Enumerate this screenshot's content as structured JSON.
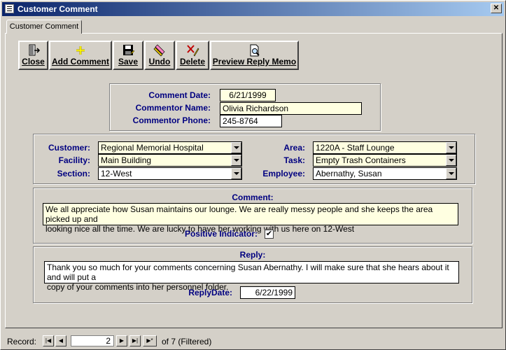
{
  "window": {
    "title": "Customer Comment"
  },
  "tab": {
    "label": "Customer Comment"
  },
  "toolbar": {
    "close": "Close",
    "add_comment": "Add Comment",
    "save": "Save",
    "undo": "Undo",
    "delete": "Delete",
    "preview_reply_memo": "Preview Reply Memo"
  },
  "commentor": {
    "date_label": "Comment Date:",
    "date": "6/21/1999",
    "name_label": "Commentor Name:",
    "name": "Olivia Richardson",
    "phone_label": "Commentor Phone:",
    "phone": "245-8764"
  },
  "location": {
    "customer_label": "Customer:",
    "customer": "Regional Memorial Hospital",
    "facility_label": "Facility:",
    "facility": "Main Building",
    "section_label": "Section:",
    "section": "12-West",
    "area_label": "Area:",
    "area": "1220A - Staff Lounge",
    "task_label": "Task:",
    "task": "Empty Trash Containers",
    "employee_label": "Employee:",
    "employee": "Abernathy, Susan"
  },
  "comment": {
    "label": "Comment:",
    "line1": "We all appreciate how Susan maintains our lounge.  We are really messy people and she keeps the area picked up and",
    "line2": "looking nice all the time.  We are lucky to have her working with us here on 12-West",
    "positive_label": "Positive Indicator:",
    "positive_mark": "✔"
  },
  "reply": {
    "label": "Reply:",
    "line1": "Thank you so much for your comments concerning Susan Abernathy.  I will make sure that she hears about it and will put a",
    "line2": "copy of your comments into her personnel folder.",
    "date_label": "ReplyDate:",
    "date": "6/22/1999"
  },
  "navigation": {
    "record_label": "Record:",
    "current": "2",
    "of_text": "of  7 (Filtered)"
  },
  "colors": {
    "title_start": "#0a246a",
    "label_text": "#000080",
    "required_field": "#ffffe1"
  }
}
